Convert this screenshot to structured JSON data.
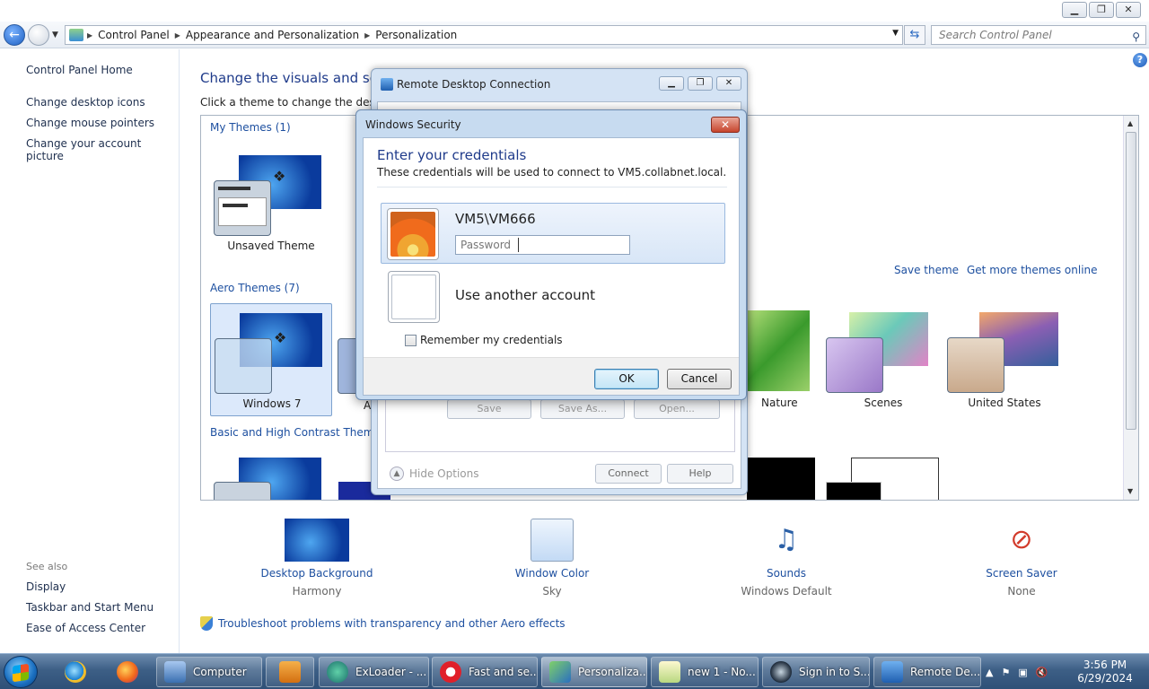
{
  "window": {
    "min": "▁",
    "max": "❐",
    "close": "✕"
  },
  "address": {
    "crumbs": [
      "Control Panel",
      "Appearance and Personalization",
      "Personalization"
    ],
    "search_placeholder": "Search Control Panel"
  },
  "sidebar": {
    "home": "Control Panel Home",
    "links": [
      "Change desktop icons",
      "Change mouse pointers",
      "Change your account picture"
    ],
    "see_also_label": "See also",
    "see_also": [
      "Display",
      "Taskbar and Start Menu",
      "Ease of Access Center"
    ]
  },
  "main": {
    "title": "Change the visuals and sou",
    "subtitle": "Click a theme to change the desktop",
    "my_themes": "My Themes (1)",
    "unsaved_theme": "Unsaved Theme",
    "save_theme": "Save theme",
    "get_more": "Get more themes online",
    "aero_themes": "Aero Themes (7)",
    "windows7": "Windows 7",
    "partial_a": "A",
    "nature": "Nature",
    "scenes": "Scenes",
    "united_states": "United States",
    "basic_themes": "Basic and High Contrast Themes ("
  },
  "customize": [
    {
      "label": "Desktop Background",
      "value": "Harmony"
    },
    {
      "label": "Window Color",
      "value": "Sky"
    },
    {
      "label": "Sounds",
      "value": "Windows Default"
    },
    {
      "label": "Screen Saver",
      "value": "None"
    }
  ],
  "troubleshoot": "Troubleshoot problems with transparency and other Aero effects",
  "rdc": {
    "title": "Remote Desktop Connection",
    "save": "Save",
    "save_as": "Save As...",
    "open": "Open...",
    "hide_options": "Hide Options",
    "connect": "Connect",
    "help": "Help"
  },
  "security": {
    "title": "Windows Security",
    "heading": "Enter your credentials",
    "description": "These credentials will be used to connect to VM5.collabnet.local.",
    "account": "VM5\\VM666",
    "password_placeholder": "Password",
    "other_account": "Use another account",
    "remember": "Remember my credentials",
    "ok": "OK",
    "cancel": "Cancel"
  },
  "taskbar": {
    "tasks": [
      "Computer",
      "ExLoader - ...",
      "Fast and se...",
      "Personaliza...",
      "new 1 - No...",
      "Sign in to S...",
      "Remote De..."
    ],
    "time": "3:56 PM",
    "date": "6/29/2024"
  },
  "colors": {
    "link": "#1e50a0",
    "heading": "#1e3a8a",
    "taskbar": "#3d5f86"
  }
}
